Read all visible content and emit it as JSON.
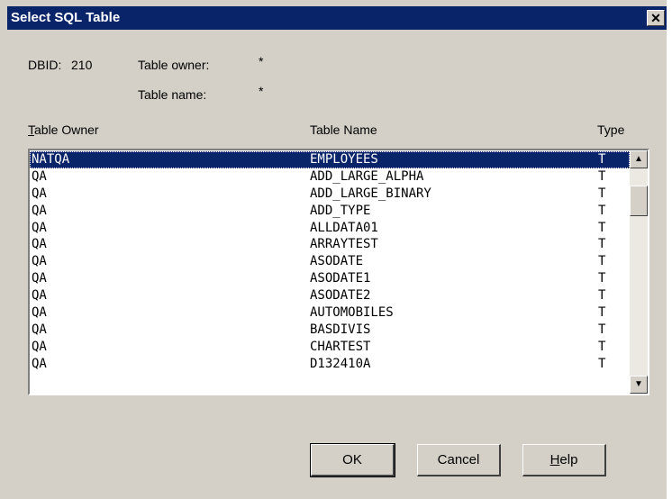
{
  "window": {
    "title": "Select SQL Table",
    "close_glyph": "✕"
  },
  "info": {
    "dbid_label": "DBID:",
    "dbid_value": "210",
    "owner_label": "Table owner:",
    "owner_value": "*",
    "name_label": "Table name:",
    "name_value": "*"
  },
  "columns": {
    "owner": "Table Owner",
    "name": "Table Name",
    "type": "Type"
  },
  "rows": [
    {
      "owner": "NATQA",
      "name": "EMPLOYEES",
      "type": "T",
      "selected": true
    },
    {
      "owner": "QA",
      "name": "ADD_LARGE_ALPHA",
      "type": "T"
    },
    {
      "owner": "QA",
      "name": "ADD_LARGE_BINARY",
      "type": "T"
    },
    {
      "owner": "QA",
      "name": "ADD_TYPE",
      "type": "T"
    },
    {
      "owner": "QA",
      "name": "ALLDATA01",
      "type": "T"
    },
    {
      "owner": "QA",
      "name": "ARRAYTEST",
      "type": "T"
    },
    {
      "owner": "QA",
      "name": "ASODATE",
      "type": "T"
    },
    {
      "owner": "QA",
      "name": "ASODATE1",
      "type": "T"
    },
    {
      "owner": "QA",
      "name": "ASODATE2",
      "type": "T"
    },
    {
      "owner": "QA",
      "name": "AUTOMOBILES",
      "type": "T"
    },
    {
      "owner": "QA",
      "name": "BASDIVIS",
      "type": "T"
    },
    {
      "owner": "QA",
      "name": "CHARTEST",
      "type": "T"
    },
    {
      "owner": "QA",
      "name": "D132410A",
      "type": "T"
    }
  ],
  "scrollbar": {
    "up_icon": "up-arrow-icon",
    "down_icon": "down-arrow-icon"
  },
  "buttons": {
    "ok": "OK",
    "cancel": "Cancel",
    "help": "Help"
  },
  "colors": {
    "selection": "#0a246a",
    "face": "#d4d0c8"
  }
}
